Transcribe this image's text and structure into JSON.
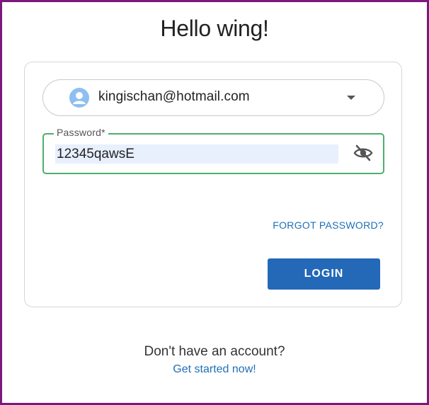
{
  "greeting": "Hello wing!",
  "account": {
    "email": "kingischan@hotmail.com",
    "avatar_icon": "person-icon",
    "dropdown_icon": "caret-down-icon"
  },
  "password": {
    "label": "Password*",
    "value": "12345qawsE",
    "toggle_icon": "eye-off-icon"
  },
  "links": {
    "forgot": "FORGOT PASSWORD?",
    "signup_prompt": "Don't have an account?",
    "signup": "Get started now!"
  },
  "login_label": "LOGIN",
  "colors": {
    "accent": "#2468b8",
    "link": "#1e6fb8",
    "focus_border": "#4caf6d",
    "avatar": "#8ebff0",
    "frame": "#7b1a7e"
  }
}
